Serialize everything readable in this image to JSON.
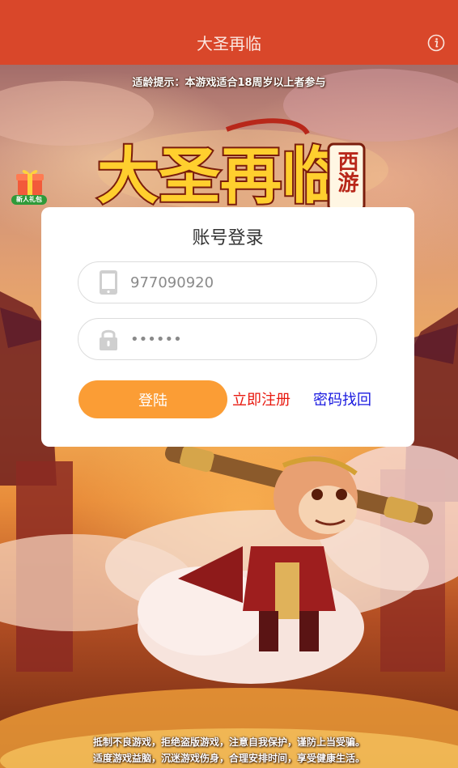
{
  "header": {
    "title": "大圣再临",
    "info_icon": "info-icon"
  },
  "banner": {
    "age_tip": "适龄提示：本游戏适合18周岁以上者参与"
  },
  "gift": {
    "icon": "gift-icon",
    "label": "新人礼包"
  },
  "logo": {
    "main": "大圣再临",
    "side": "西游"
  },
  "login": {
    "title": "账号登录",
    "account": {
      "icon": "phone-icon",
      "value": "977090920"
    },
    "password": {
      "icon": "lock-icon",
      "value": "••••••"
    },
    "submit_label": "登陆",
    "register_label": "立即注册",
    "recover_label": "密码找回"
  },
  "footer": {
    "line1": "抵制不良游戏，拒绝盗版游戏，注意自我保护，谨防上当受骗。",
    "line2": "适度游戏益脑，沉迷游戏伤身，合理安排时间，享受健康生活。"
  },
  "colors": {
    "header": "#d9472a",
    "login_button": "#fb9d35",
    "register_link": "#e8190f",
    "recover_link": "#1a1ae0"
  }
}
